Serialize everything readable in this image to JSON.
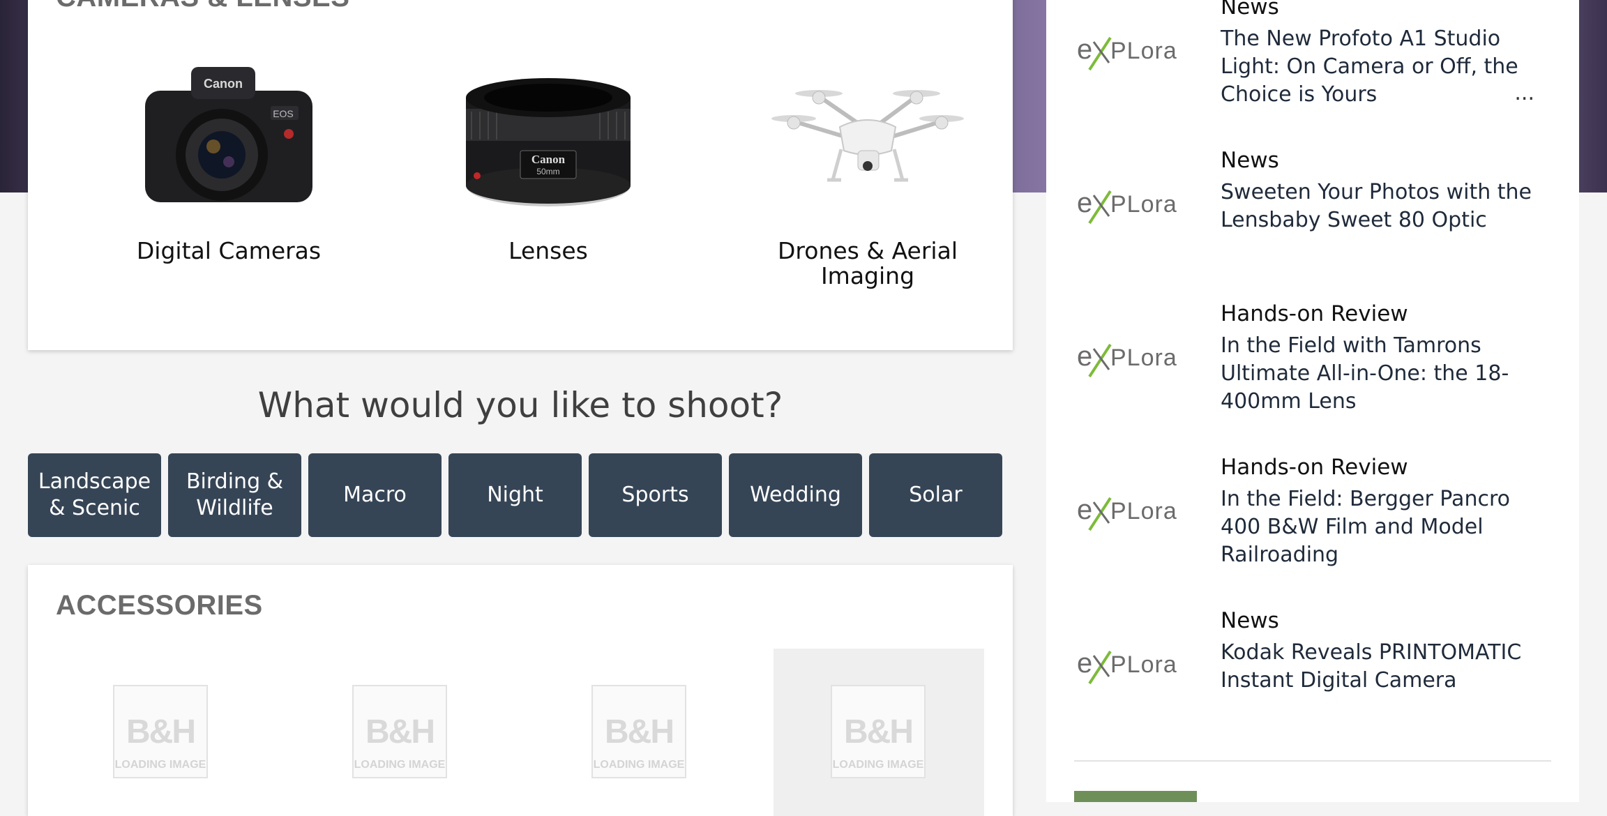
{
  "cameras": {
    "title": "CAMERAS & LENSES",
    "items": [
      {
        "label": "Digital Cameras",
        "icon": "dslr-camera-icon"
      },
      {
        "label": "Lenses",
        "icon": "lens-icon"
      },
      {
        "label": "Drones & Aerial Imaging",
        "icon": "drone-icon"
      }
    ]
  },
  "shoot": {
    "heading": "What would you like to shoot?",
    "buttons": [
      "Landscape & Scenic",
      "Birding & Wildlife",
      "Macro",
      "Night",
      "Sports",
      "Wedding",
      "Solar"
    ]
  },
  "accessories": {
    "title": "ACCESSORIES",
    "placeholder_logo": "B&H",
    "placeholder_text": "LOADING IMAGE"
  },
  "sidebar": {
    "logo_text": "explora",
    "news": [
      {
        "category": "News",
        "title": "The New Profoto A1 Studio Light: On Camera or Off, the Choice is Yours",
        "ellipsis": "..."
      },
      {
        "category": "News",
        "title": "Sweeten Your Photos with the Lensbaby Sweet 80 Optic"
      },
      {
        "category": "Hands-on Review",
        "title": "In the Field with Tamrons Ultimate All-in-One: the 18-400mm Lens"
      },
      {
        "category": "Hands-on Review",
        "title": "In the Field: Bergger Pancro 400 B&W Film and Model Railroading"
      },
      {
        "category": "News",
        "title": "Kodak Reveals PRINTOMATIC Instant Digital Camera"
      }
    ]
  },
  "colors": {
    "button_bg": "#364556",
    "explora_green": "#7dbb3a",
    "explora_gray": "#6b6b6b"
  }
}
